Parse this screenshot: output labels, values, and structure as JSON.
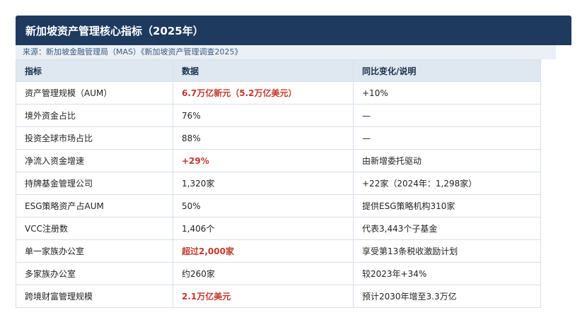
{
  "title": "新加坡资产管理核心指标（2025年）",
  "source": "来源：新加坡金融管理局（MAS）《新加坡资产管理调查2025》",
  "columns": [
    "指标",
    "数据",
    "同比变化/说明"
  ],
  "rows": [
    {
      "metric": "资产管理规模（AUM）",
      "value": "6.7万亿新元（5.2万亿美元）",
      "note": "+10%",
      "highlight": true
    },
    {
      "metric": "境外资金占比",
      "value": "76%",
      "note": "—",
      "highlight": false
    },
    {
      "metric": "投资全球市场占比",
      "value": "88%",
      "note": "—",
      "highlight": false
    },
    {
      "metric": "净流入资金增速",
      "value": "+29%",
      "note": "由新增委托驱动",
      "highlight": true
    },
    {
      "metric": "持牌基金管理公司",
      "value": "1,320家",
      "note": "+22家（2024年：1,298家）",
      "highlight": false
    },
    {
      "metric": "ESG策略资产占AUM",
      "value": "50%",
      "note": "提供ESG策略机构310家",
      "highlight": false
    },
    {
      "metric": "VCC注册数",
      "value": "1,406个",
      "note": "代表3,443个子基金",
      "highlight": false
    },
    {
      "metric": "单一家族办公室",
      "value": "超过2,000家",
      "note": "享受第13条税收激励计划",
      "highlight": true
    },
    {
      "metric": "多家族办公室",
      "value": "约260家",
      "note": "较2023年+34%",
      "highlight": false
    },
    {
      "metric": "跨境财富管理规模",
      "value": "2.1万亿美元",
      "note": "预计2030年增至3.3万亿",
      "highlight": true
    }
  ]
}
